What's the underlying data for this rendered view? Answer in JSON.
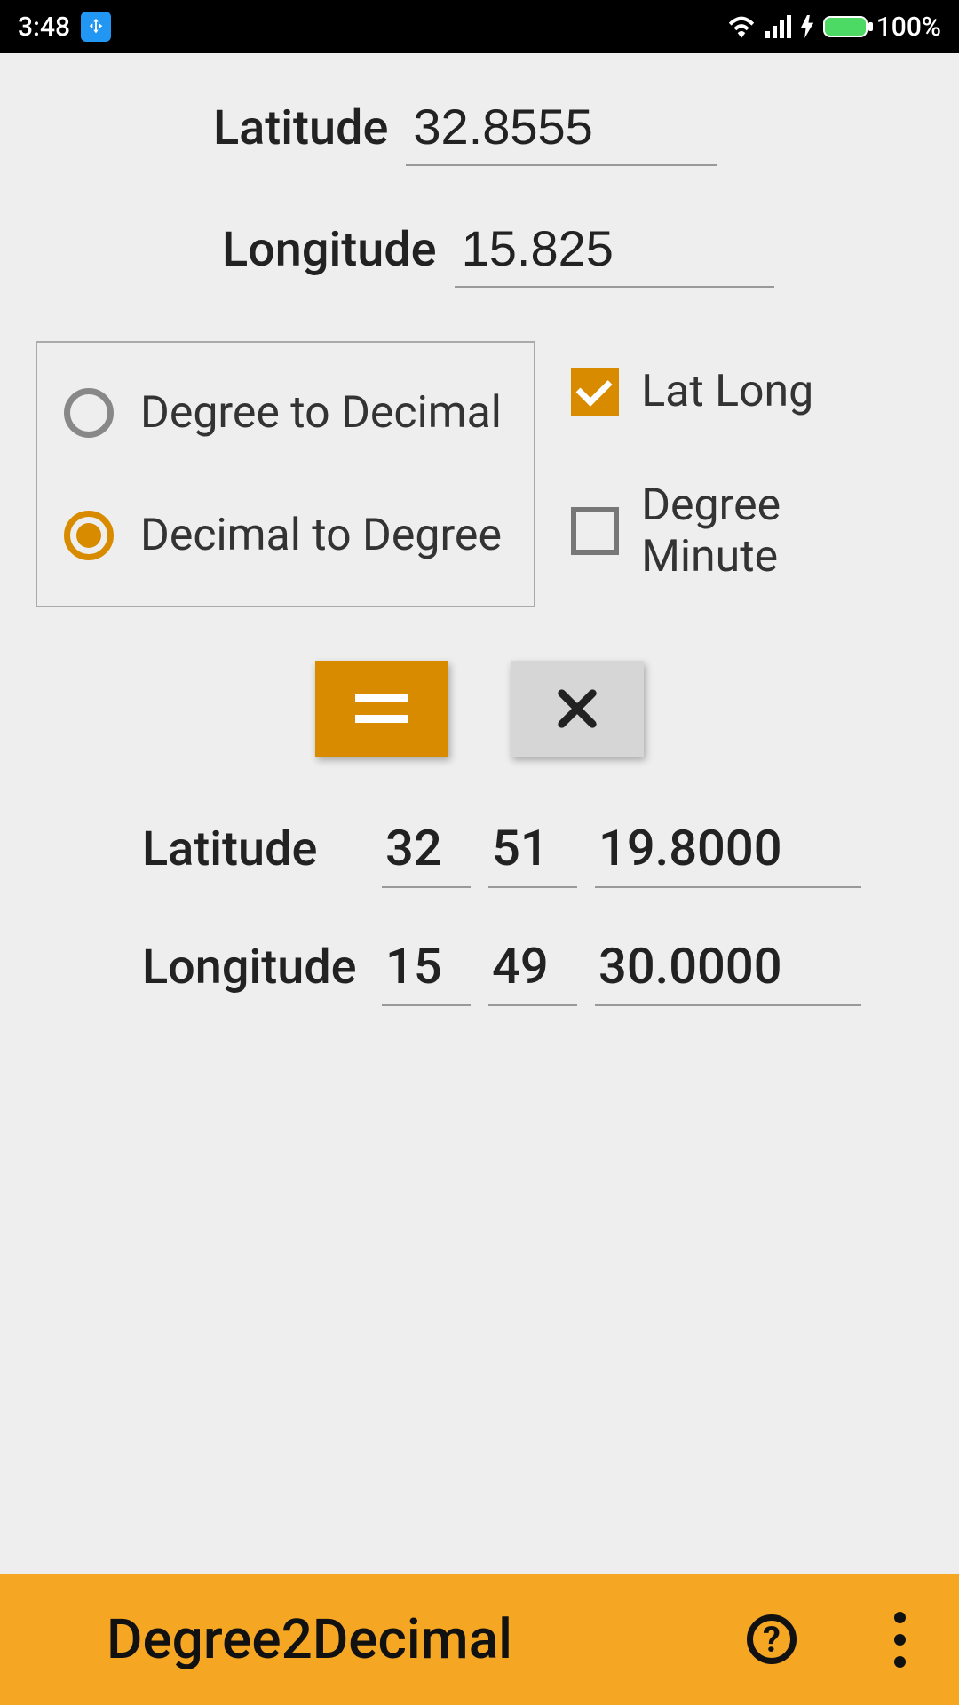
{
  "statusbar": {
    "time": "3:48",
    "battery_pct": "100%"
  },
  "inputs": {
    "latitude_label": "Latitude",
    "latitude_value": "32.8555",
    "longitude_label": "Longitude",
    "longitude_value": "15.825"
  },
  "radios": {
    "degree_to_decimal": "Degree to Decimal",
    "decimal_to_degree": "Decimal to Degree"
  },
  "checks": {
    "lat_long": "Lat Long",
    "degree_minute": "Degree Minute"
  },
  "results": {
    "latitude_label": "Latitude",
    "lat_deg": "32",
    "lat_min": "51",
    "lat_sec": "19.8000",
    "longitude_label": "Longitude",
    "lon_deg": "15",
    "lon_min": "49",
    "lon_sec": "30.0000"
  },
  "bottombar": {
    "title": "Degree2Decimal"
  }
}
